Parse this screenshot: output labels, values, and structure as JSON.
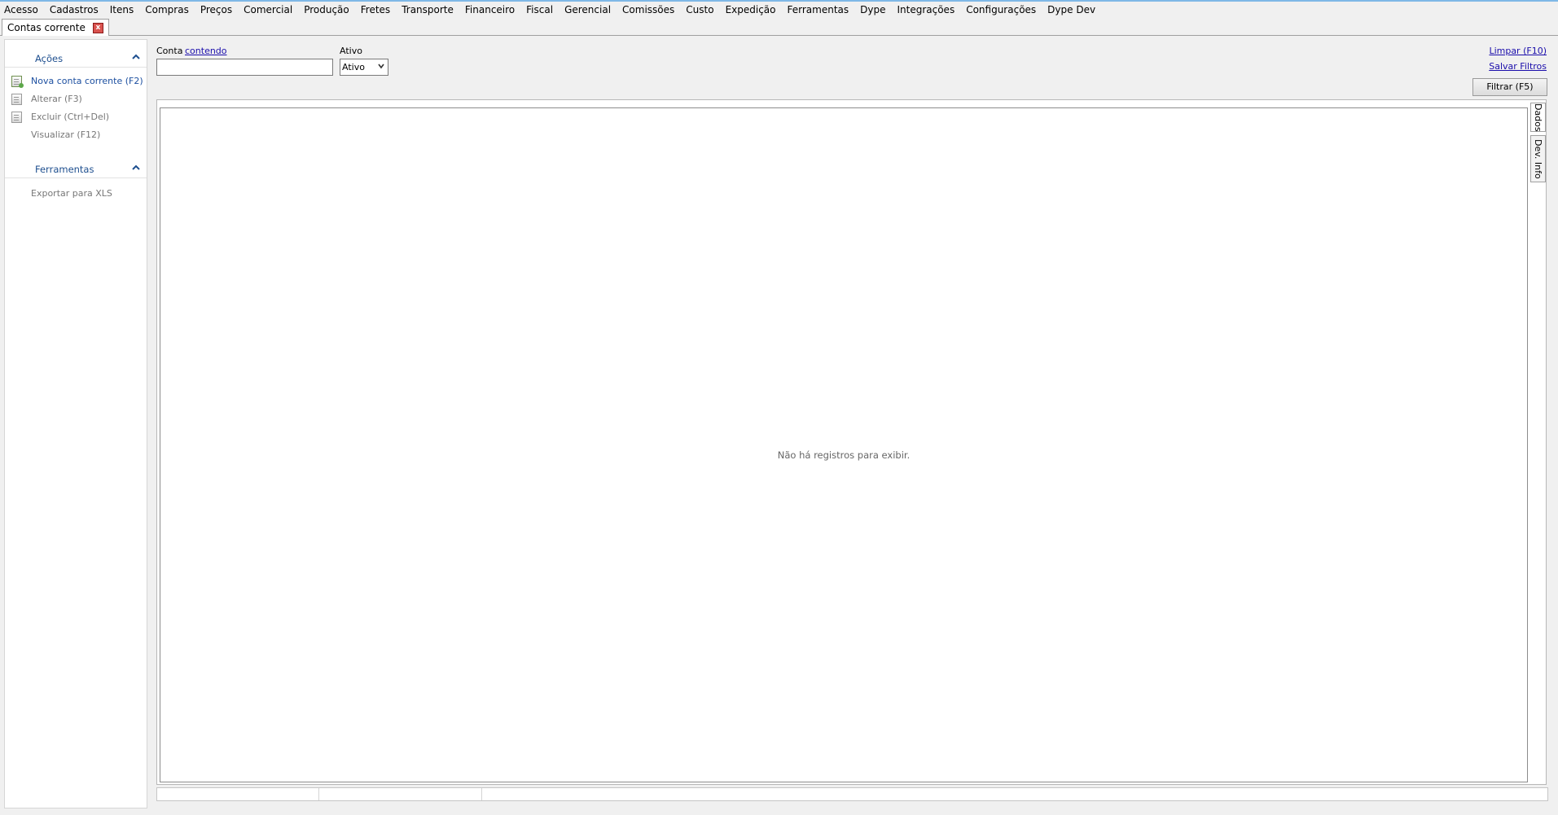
{
  "menu": [
    "Acesso",
    "Cadastros",
    "Itens",
    "Compras",
    "Preços",
    "Comercial",
    "Produção",
    "Fretes",
    "Transporte",
    "Financeiro",
    "Fiscal",
    "Gerencial",
    "Comissões",
    "Custo",
    "Expedição",
    "Ferramentas",
    "Dype",
    "Integrações",
    "Configurações",
    "Dype Dev"
  ],
  "tab": {
    "label": "Contas corrente",
    "close": "x"
  },
  "sidebar": {
    "acoes": {
      "title": "Ações",
      "items": [
        {
          "label": "Nova conta corrente (F2)",
          "icon": "new-document-icon"
        },
        {
          "label": "Alterar (F3)",
          "icon": "edit-document-icon"
        },
        {
          "label": "Excluir (Ctrl+Del)",
          "icon": "delete-document-icon"
        },
        {
          "label": "Visualizar (F12)",
          "icon": ""
        }
      ]
    },
    "ferramentas": {
      "title": "Ferramentas",
      "items": [
        {
          "label": "Exportar para XLS"
        }
      ]
    }
  },
  "filters": {
    "conta_label": "Conta",
    "conta_mode_link": "contendo",
    "conta_value": "",
    "ativo_label": "Ativo",
    "ativo_value": "Ativo"
  },
  "links": {
    "limpar": "Limpar (F10)",
    "salvar": "Salvar Filtros"
  },
  "buttons": {
    "filtrar": "Filtrar (F5)"
  },
  "grid": {
    "empty_message": "Não há registros para exibir."
  },
  "side_tabs": [
    "Dados",
    "Dev. Info"
  ],
  "colors": {
    "accent": "#1e4f8f",
    "link": "#1a0dab"
  }
}
